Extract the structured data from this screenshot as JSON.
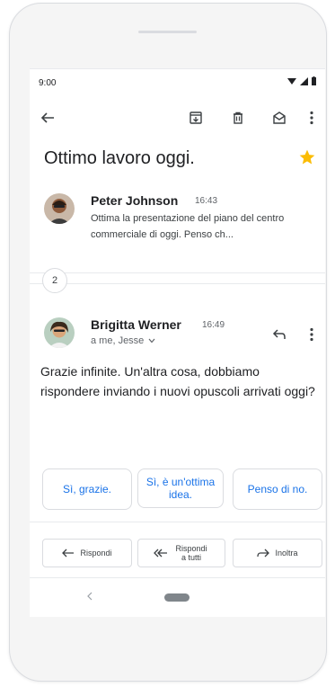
{
  "status_bar": {
    "time": "9:00"
  },
  "toolbar": {
    "back_icon": "arrow-back-icon",
    "archive_icon": "archive-icon",
    "delete_icon": "trash-icon",
    "mark_unread_icon": "mail-open-icon",
    "more_icon": "more-vert-icon"
  },
  "thread": {
    "subject": "Ottimo lavoro oggi.",
    "starred": true,
    "star_color": "#fbbc04",
    "collapsed_count": "2",
    "messages": [
      {
        "sender": "Peter Johnson",
        "time": "16:43",
        "snippet": "Ottima la presentazione del piano del centro commerciale di oggi. Penso ch..."
      },
      {
        "sender": "Brigitta Werner",
        "time": "16:49",
        "recipients": "a me, Jesse",
        "body": "Grazie infinite. Un'altra cosa, dobbiamo rispondere inviando i nuovi opuscoli arrivati oggi?"
      }
    ]
  },
  "smart_replies": [
    "Sì, grazie.",
    "Sì, è un'ottima idea.",
    "Penso di no."
  ],
  "actions": {
    "reply": "Rispondi",
    "reply_all": "Rispondi a tutti",
    "forward": "Inoltra"
  },
  "accent_color": "#1a73e8"
}
